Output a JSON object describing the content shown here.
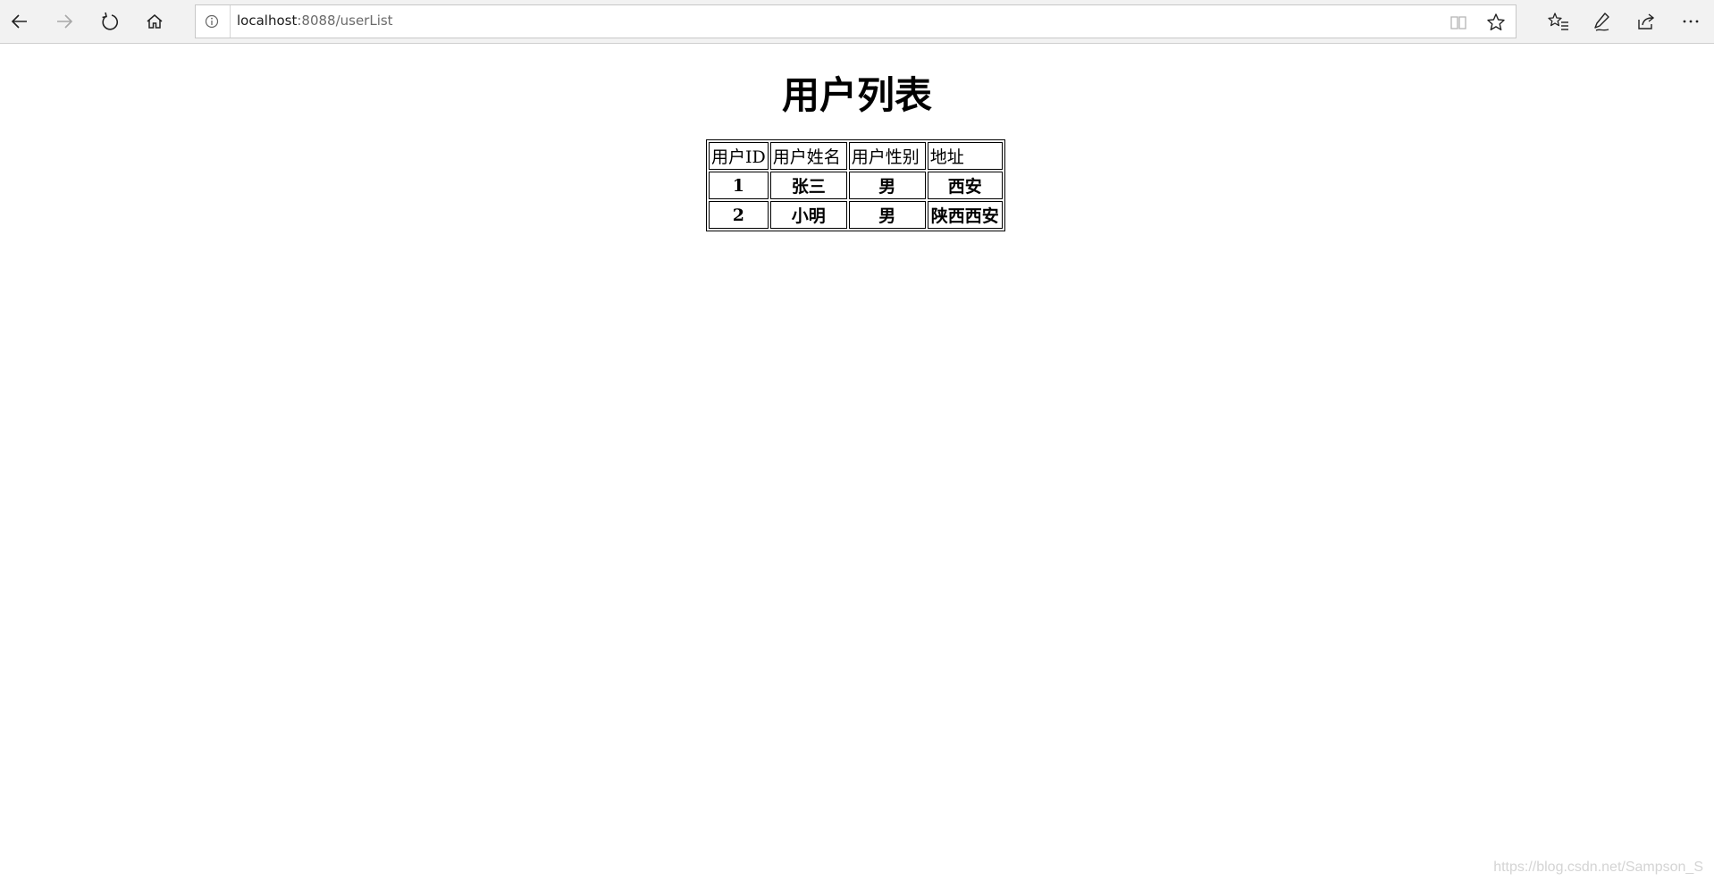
{
  "browser": {
    "url_host": "localhost",
    "url_path": ":8088/userList",
    "icons": {
      "back": "arrow-left-icon",
      "forward": "arrow-right-icon",
      "refresh": "refresh-icon",
      "home": "home-icon",
      "site_info": "info-icon",
      "reading_view": "book-icon",
      "favorite": "star-icon",
      "favorites_hub": "favorites-list-icon",
      "notes": "pen-icon",
      "share": "share-icon",
      "more": "ellipsis-icon"
    }
  },
  "page": {
    "title": "用户列表",
    "table": {
      "headers": [
        "用户ID",
        "用户姓名",
        "用户性别",
        "地址"
      ],
      "rows": [
        [
          "1",
          "张三",
          "男",
          "西安"
        ],
        [
          "2",
          "小明",
          "男",
          "陕西西安"
        ]
      ]
    }
  },
  "watermark": "https://blog.csdn.net/Sampson_S"
}
